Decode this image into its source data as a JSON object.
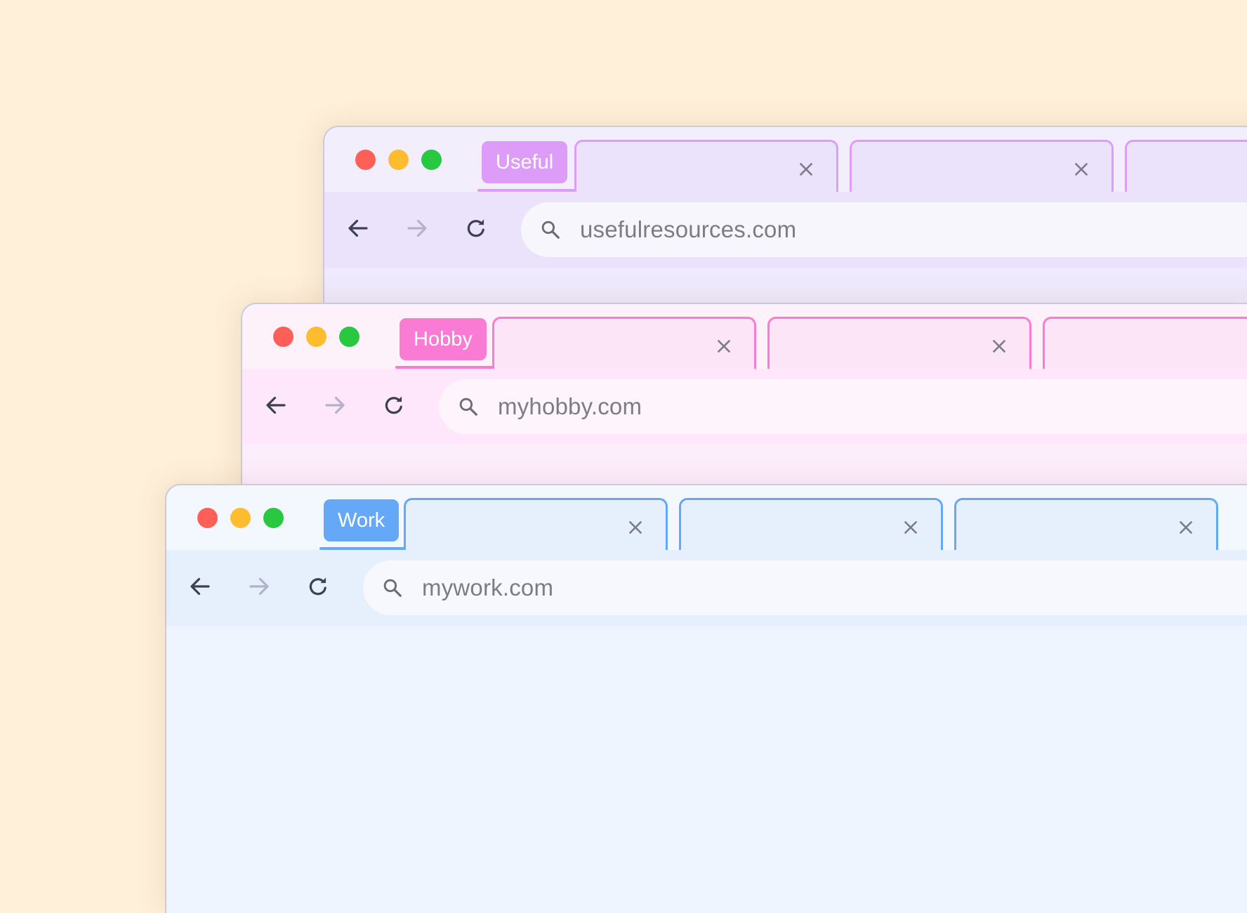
{
  "windows": [
    {
      "id": "useful",
      "group_label": "Useful",
      "url": "usefulresources.com",
      "tab_count": 3,
      "colors": {
        "accent": "#dd9cf8",
        "titlebar": "#f3eefc",
        "tab_fill": "#eae3fb",
        "toolbar": "#eae3fb",
        "address": "#f8f6fd",
        "content": "#efeafd"
      }
    },
    {
      "id": "hobby",
      "group_label": "Hobby",
      "url": "myhobby.com",
      "tab_count": 3,
      "colors": {
        "accent": "#fa7bd3",
        "titlebar": "#fdf1fa",
        "tab_fill": "#fde5f8",
        "toolbar": "#fee6fb",
        "address": "#fdf4fc",
        "content": "#fdeefc"
      }
    },
    {
      "id": "work",
      "group_label": "Work",
      "url": "mywork.com",
      "tab_count": 3,
      "colors": {
        "accent": "#66a8f8",
        "titlebar": "#f3f7fe",
        "tab_fill": "#e6effc",
        "toolbar": "#e6effc",
        "address": "#f6f8fe",
        "content": "#eff5ff"
      }
    }
  ],
  "icons": {
    "window_controls": [
      "close-dot",
      "minimize-dot",
      "maximize-dot"
    ],
    "tab": "close-icon",
    "toolbar": [
      "arrow-left-icon",
      "arrow-right-icon",
      "reload-icon"
    ],
    "address": "search-icon"
  }
}
